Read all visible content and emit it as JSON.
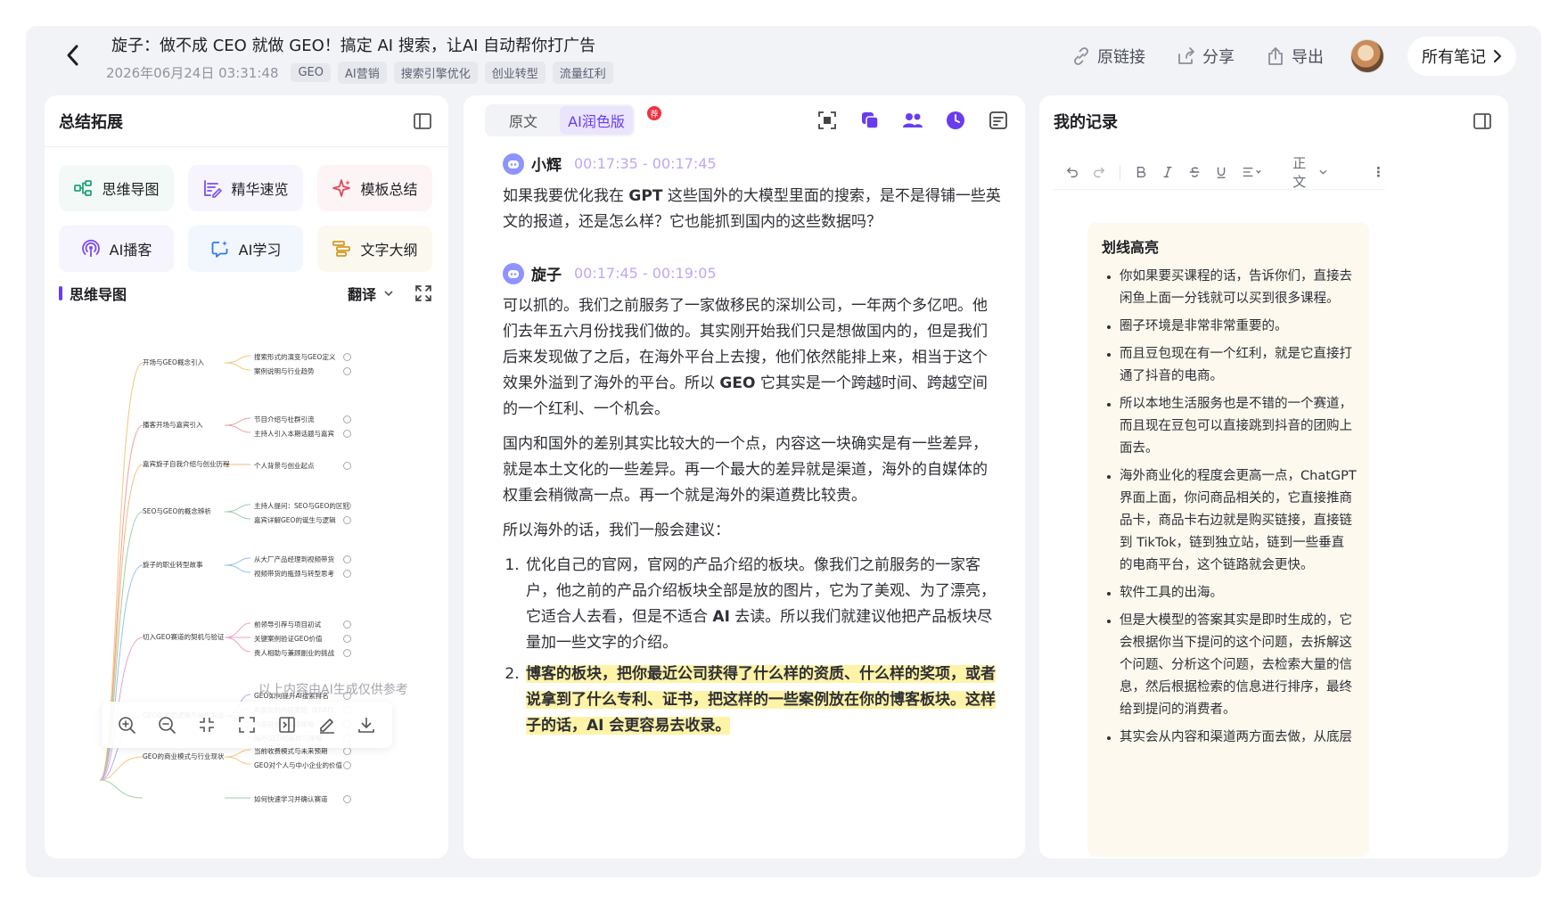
{
  "header": {
    "title": "旋子：做不成 CEO 就做 GEO！搞定 AI 搜索，让AI 自动帮你打广告",
    "date": "2026年06月24日 03:31:48",
    "tags": [
      "GEO",
      "AI营销",
      "搜索引擎优化",
      "创业转型",
      "流量红利"
    ],
    "actions": {
      "link": "原链接",
      "share": "分享",
      "export": "导出"
    },
    "all_notes": "所有笔记"
  },
  "left": {
    "title": "总结拓展",
    "tools": [
      "思维导图",
      "精华速览",
      "模板总结",
      "AI播客",
      "AI学习",
      "文字大纲"
    ],
    "mindmap_title": "思维导图",
    "translate": "翻译",
    "note": "以上内容由AI生成仅供参考",
    "mindmap": {
      "branches": [
        {
          "label": "开场与GEO概念引入",
          "children": [
            "搜索形式的演变与GEO定义",
            "案例说明与行业趋势"
          ]
        },
        {
          "label": "播客开场与嘉宾引入",
          "children": [
            "节目介绍与社群引流",
            "主持人引入本期话题与嘉宾"
          ]
        },
        {
          "label": "嘉宾旋子自我介绍与创业历程",
          "children": [
            "个人背景与创业起点"
          ]
        },
        {
          "label": "SEO与GEO的概念辨析",
          "children": [
            "主持人提问：SEO与GEO的区别",
            "嘉宾详解GEO的诞生与逻辑"
          ]
        },
        {
          "label": "旋子的职业转型故事",
          "children": [
            "从大厂产品经理到视频带货",
            "视频带货的瓶颈与转型思考"
          ]
        },
        {
          "label": "切入GEO赛道的契机与验证",
          "children": [
            "前领导引荐与项目初试",
            "关键案例验证GEO价值",
            "贵人相助与兼顾副业的挑战"
          ]
        },
        {
          "label": "GEO的底层逻辑与操作方法",
          "children": [
            "GEO如何提升AI搜索排名",
            "AI喜欢的内容原则（EEAT）",
            "内容投放的渠道策略",
            "海外GEO的差异与策略"
          ]
        },
        {
          "label": "GEO的商业模式与行业现状",
          "children": [
            "当前收费模式与未来预期",
            "GEO对个人与中小企业的价值"
          ]
        },
        {
          "label": "",
          "children": [
            "如何快速学习并确认赛道"
          ]
        }
      ]
    }
  },
  "middle": {
    "tabs": [
      "原文",
      "AI润色版"
    ],
    "badge": "荐",
    "blocks": [
      {
        "speaker": "小辉",
        "time": "00:17:35 - 00:17:45"
      },
      {
        "speaker": "旋子",
        "time": "00:17:45 - 00:19:05"
      }
    ],
    "p1_a": "如果我要优化我在 ",
    "p1_b": "GPT",
    "p1_c": " 这些国外的大模型里面的搜索，是不是得铺一些英文的报道，还是怎么样？它也能抓到国内的这些数据吗？",
    "p2_a": "可以抓的。我们之前服务了一家做移民的深圳公司，一年两个多亿吧。他们去年五六月份找我们做的。其实刚开始我们只是想做国内的，但是我们后来发现做了之后，在海外平台上去搜，他们依然能排上来，相当于这个效果外溢到了海外的平台。所以 ",
    "p2_b": "GEO",
    "p2_c": " 它其实是一个跨越时间、跨越空间的一个红利、一个机会。",
    "p3": "国内和国外的差别其实比较大的一个点，内容这一块确实是有一些差异，就是本土文化的一些差异。再一个最大的差异就是渠道，海外的自媒体的权重会稍微高一点。再一个就是海外的渠道费比较贵。",
    "p4": "所以海外的话，我们一般会建议：",
    "li1_a": "优化自己的官网，官网的产品介绍的板块。像我们之前服务的一家客户，他之前的产品介绍板块全部是放的图片，它为了美观、为了漂亮，它适合人去看，但是不适合 ",
    "li1_b": "AI",
    "li1_c": " 去读。所以我们就建议他把产品板块尽量加一些文字的介绍。",
    "li2": "博客的板块，把你最近公司获得了什么样的资质、什么样的奖项，或者说拿到了什么专利、证书，把这样的一些案例放在你的博客板块。这样子的话，AI 会更容易去收录。"
  },
  "right": {
    "title": "我的记录",
    "toolbar": {
      "para_style": "正文"
    },
    "note_title": "划线高亮",
    "notes": [
      "你如果要买课程的话，告诉你们，直接去闲鱼上面一分钱就可以买到很多课程。",
      "圈子环境是非常非常重要的。",
      "而且豆包现在有一个红利，就是它直接打通了抖音的电商。",
      "所以本地生活服务也是不错的一个赛道，而且现在豆包可以直接跳到抖音的团购上面去。",
      "海外商业化的程度会更高一点，ChatGPT 界面上面，你问商品相关的，它直接推商品卡，商品卡右边就是购买链接，直接链到 TikTok，链到独立站，链到一些垂直的电商平台，这个链路就会更快。",
      "软件工具的出海。",
      "但是大模型的答案其实是即时生成的，它会根据你当下提问的这个问题，去拆解这个问题、分析这个问题，去检索大量的信息，然后根据检索的信息进行排序，最终给到提问的消费者。",
      "其实会从内容和渠道两方面去做，从底层"
    ]
  },
  "colors": {
    "accent": "#6a3cf0",
    "highlight": "#fff3a8",
    "time": "#c0a7f5",
    "note_bg": "#fdf9ee"
  }
}
